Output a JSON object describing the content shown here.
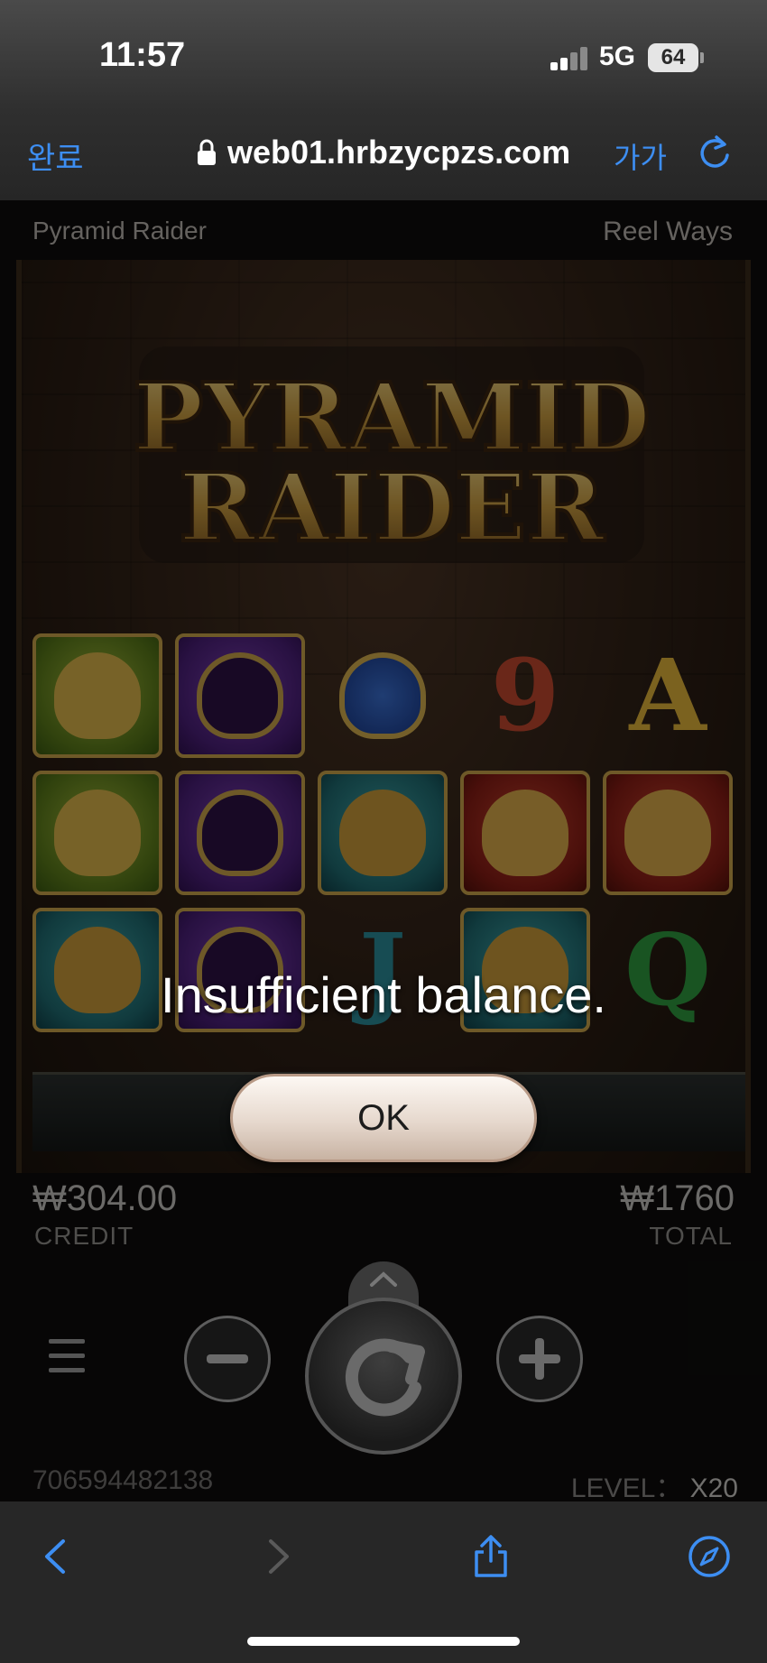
{
  "status_bar": {
    "time": "11:57",
    "network": "5G",
    "battery": "64"
  },
  "browser": {
    "done_label": "완료",
    "url": "web01.hrbzycpzs.com",
    "text_size_label": "가가"
  },
  "game": {
    "title": "Pyramid Raider",
    "mode": "Reel Ways",
    "logo_line1": "PYRAMID",
    "logo_line2": "RAIDER",
    "credit_value": "₩304.00",
    "credit_label": "CREDIT",
    "total_value": "₩1760",
    "total_label": "TOTAL",
    "session_id": "706594482138",
    "level_label": "LEVEL：",
    "level_value": "X20",
    "reel_letters": {
      "nine": "9",
      "ace": "A",
      "jack": "J",
      "queen": "Q"
    }
  },
  "dialog": {
    "message": "Insufficient balance.",
    "ok_label": "OK"
  },
  "colors": {
    "accent_blue": "#3d8ef2",
    "gold": "#c9a34a"
  }
}
